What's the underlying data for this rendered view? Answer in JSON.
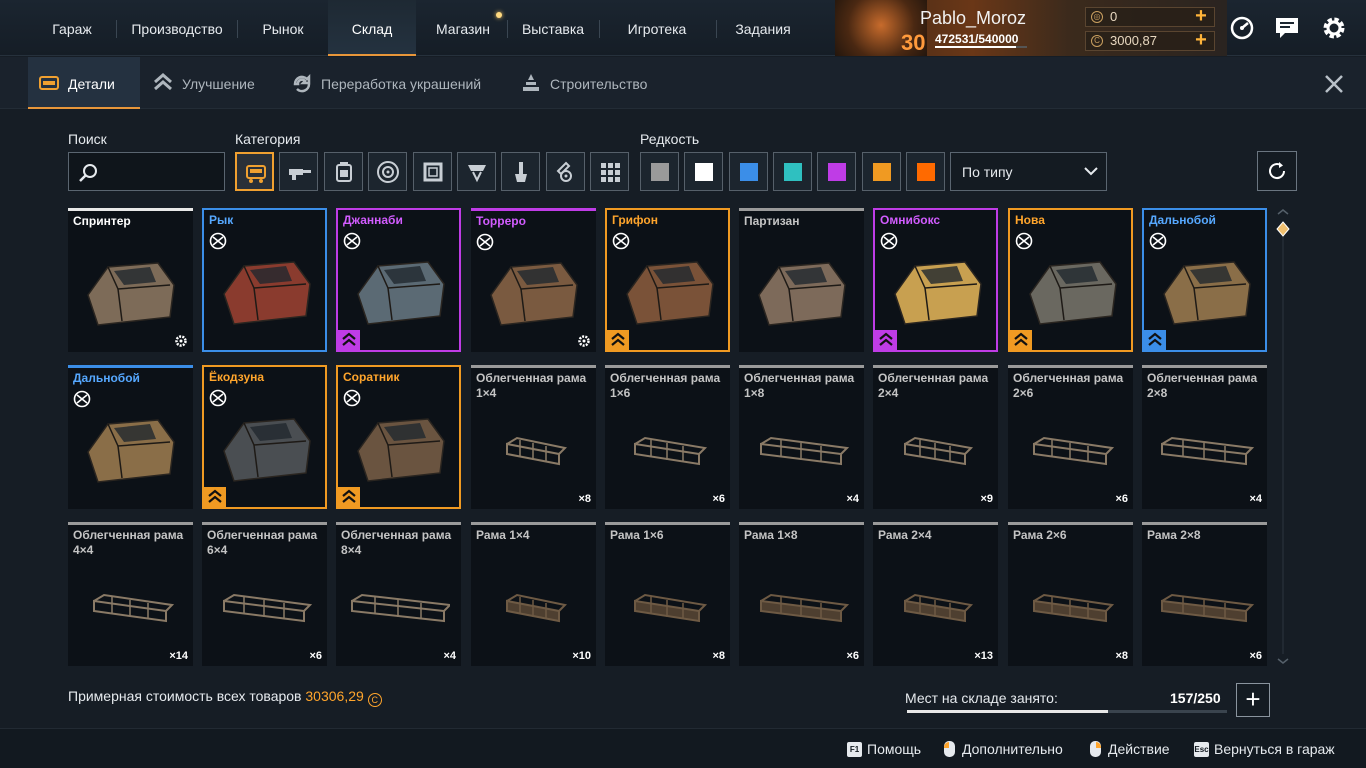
{
  "nav": {
    "items": [
      {
        "label": "Гараж",
        "active": false
      },
      {
        "label": "Производство",
        "active": false
      },
      {
        "label": "Рынок",
        "active": false
      },
      {
        "label": "Склад",
        "active": true
      },
      {
        "label": "Магазин",
        "active": false
      },
      {
        "label": "Выставка",
        "active": false
      },
      {
        "label": "Игротека",
        "active": false
      },
      {
        "label": "Задания",
        "active": false
      }
    ]
  },
  "profile": {
    "username": "Pablo_Moroz",
    "level": "30",
    "xp": "472531/540000",
    "xp_progress": 0.875,
    "currency_1": "0",
    "currency_2": "3000,87"
  },
  "subtabs": [
    {
      "label": "Детали",
      "icon": "parts-icon",
      "active": true
    },
    {
      "label": "Улучшение",
      "icon": "upgrade-icon",
      "active": false
    },
    {
      "label": "Переработка украшений",
      "icon": "recycle-icon",
      "active": false
    },
    {
      "label": "Строительство",
      "icon": "build-icon",
      "active": false
    }
  ],
  "filters": {
    "search_label": "Поиск",
    "search_value": "",
    "category_label": "Категория",
    "categories": [
      "cabin-icon",
      "weapon-icon",
      "module-icon",
      "wheel-icon",
      "frame-icon",
      "structure-icon",
      "decor-icon",
      "paint-icon",
      "misc-icon"
    ],
    "rarity_label": "Редкость",
    "rarities": [
      "#9a9a9a",
      "#ffffff",
      "#3b8ee8",
      "#2fc0c0",
      "#bf3ce6",
      "#f09a22",
      "#ff6a00"
    ],
    "sort_value": "По типу"
  },
  "items": [
    {
      "name": "Спринтер",
      "rarity": "white",
      "icon": "gear",
      "qty": ""
    },
    {
      "name": "Рык",
      "rarity": "blue",
      "icon": "",
      "qty": ""
    },
    {
      "name": "Джаннаби",
      "rarity": "purple",
      "icon": "badge",
      "qty": ""
    },
    {
      "name": "Торреро",
      "rarity": "purple-top",
      "icon": "gear",
      "qty": ""
    },
    {
      "name": "Грифон",
      "rarity": "orange",
      "icon": "badge",
      "qty": ""
    },
    {
      "name": "Партизан",
      "rarity": "gray",
      "icon": "",
      "qty": ""
    },
    {
      "name": "Омнибокс",
      "rarity": "purple",
      "icon": "badge",
      "qty": ""
    },
    {
      "name": "Нова",
      "rarity": "orange",
      "icon": "badge",
      "qty": ""
    },
    {
      "name": "Дальнобой",
      "rarity": "blue",
      "icon": "badge",
      "qty": ""
    },
    {
      "name": "Дальнобой",
      "rarity": "blue-top",
      "icon": "",
      "qty": ""
    },
    {
      "name": "Ёкодзуна",
      "rarity": "orange",
      "icon": "badge",
      "qty": ""
    },
    {
      "name": "Соратник",
      "rarity": "orange",
      "icon": "badge",
      "qty": ""
    },
    {
      "name": "Облегченная рама 1×4",
      "rarity": "gray",
      "icon": "",
      "qty": "×8"
    },
    {
      "name": "Облегченная рама 1×6",
      "rarity": "gray",
      "icon": "",
      "qty": "×6"
    },
    {
      "name": "Облегченная рама 1×8",
      "rarity": "gray",
      "icon": "",
      "qty": "×4"
    },
    {
      "name": "Облегченная рама 2×4",
      "rarity": "gray",
      "icon": "",
      "qty": "×9"
    },
    {
      "name": "Облегченная рама 2×6",
      "rarity": "gray",
      "icon": "",
      "qty": "×6"
    },
    {
      "name": "Облегченная рама 2×8",
      "rarity": "gray",
      "icon": "",
      "qty": "×4"
    },
    {
      "name": "Облегченная рама 4×4",
      "rarity": "gray",
      "icon": "",
      "qty": "×14"
    },
    {
      "name": "Облегченная рама 6×4",
      "rarity": "gray",
      "icon": "",
      "qty": "×6"
    },
    {
      "name": "Облегченная рама 8×4",
      "rarity": "gray",
      "icon": "",
      "qty": "×4"
    },
    {
      "name": "Рама 1×4",
      "rarity": "gray",
      "icon": "",
      "qty": "×10"
    },
    {
      "name": "Рама 1×6",
      "rarity": "gray",
      "icon": "",
      "qty": "×8"
    },
    {
      "name": "Рама 1×8",
      "rarity": "gray",
      "icon": "",
      "qty": "×6"
    },
    {
      "name": "Рама 2×4",
      "rarity": "gray",
      "icon": "",
      "qty": "×13"
    },
    {
      "name": "Рама 2×6",
      "rarity": "gray",
      "icon": "",
      "qty": "×8"
    },
    {
      "name": "Рама 2×8",
      "rarity": "gray",
      "icon": "",
      "qty": "×6"
    }
  ],
  "footer": {
    "value_label": "Примерная стоимость всех товаров",
    "value_amount": "30306,29",
    "capacity_label": "Мест на складе занято:",
    "capacity_value": "157/250",
    "capacity_fraction": 0.628
  },
  "hints": [
    {
      "key": "F1",
      "label": "Помощь"
    },
    {
      "key": "mouse-left",
      "label": "Дополнительно"
    },
    {
      "key": "mouse-right",
      "label": "Действие"
    },
    {
      "key": "Esc",
      "label": "Вернуться в гараж"
    }
  ]
}
